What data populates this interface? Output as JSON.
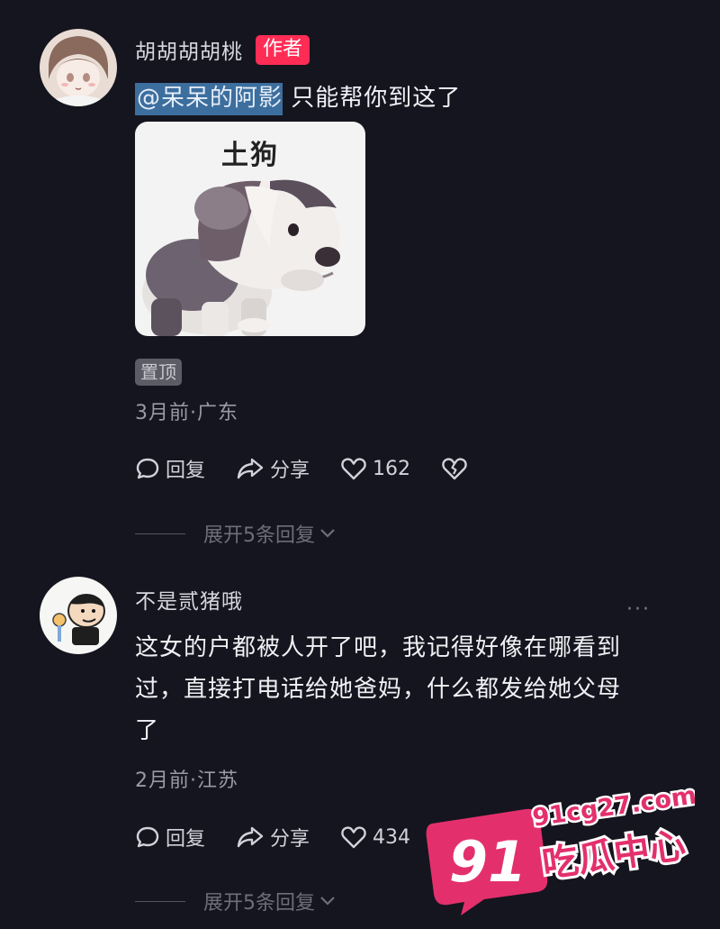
{
  "comments": [
    {
      "author": "胡胡胡胡桃",
      "badge": "作者",
      "mention": "@呆呆的阿影",
      "text": " 只能帮你到这了",
      "sticker_caption": "土狗",
      "pin_tag": "置顶",
      "meta": "3月前·广东",
      "reply_label": "回复",
      "share_label": "分享",
      "likes": "162",
      "expand_label": "展开5条回复"
    },
    {
      "author": "不是贰猪哦",
      "more": "···",
      "text_lines": [
        "这女的户都被人开了吧，我记得好像在哪看到",
        "过，直接打电话给她爸妈，什么都发给她父母",
        "了"
      ],
      "meta": "2月前·江苏",
      "reply_label": "回复",
      "share_label": "分享",
      "likes": "434",
      "expand_label": "展开5条回复"
    }
  ],
  "watermark": {
    "number": "91",
    "domain": "91cg27.com",
    "title": "吃瓜中心"
  },
  "colors": {
    "background": "#15151f",
    "badge": "#ff2d55",
    "mention_highlight": "#3c6e9e",
    "watermark": "#e3306c"
  }
}
